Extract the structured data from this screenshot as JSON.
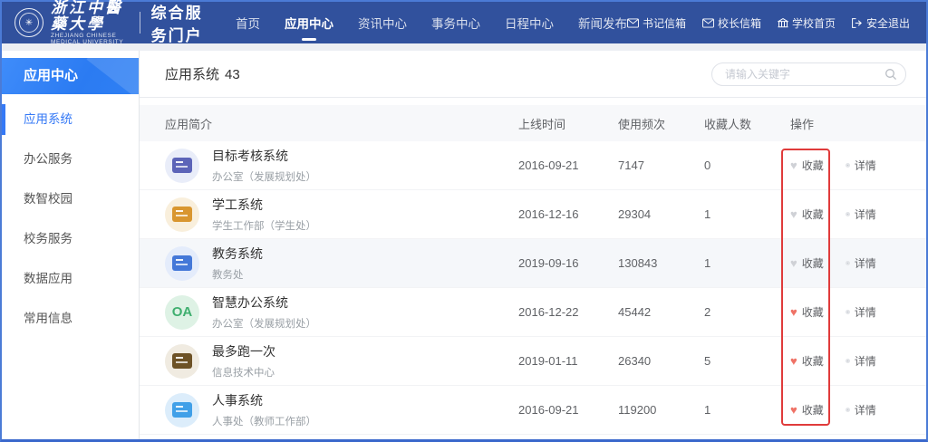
{
  "navbar": {
    "university_name": "浙江中醫藥大學",
    "university_name_en": "ZHEJIANG CHINESE MEDICAL UNIVERSITY",
    "portal_title": "综合服务门户",
    "items": [
      {
        "label": "首页",
        "active": false
      },
      {
        "label": "应用中心",
        "active": true
      },
      {
        "label": "资讯中心",
        "active": false
      },
      {
        "label": "事务中心",
        "active": false
      },
      {
        "label": "日程中心",
        "active": false
      },
      {
        "label": "新闻发布",
        "active": false
      }
    ],
    "right_links": [
      {
        "icon": "envelope-icon",
        "label": "书记信箱"
      },
      {
        "icon": "envelope-icon",
        "label": "校长信箱"
      },
      {
        "icon": "building-icon",
        "label": "学校首页"
      },
      {
        "icon": "logout-icon",
        "label": "安全退出"
      }
    ]
  },
  "sidebar": {
    "header": "应用中心",
    "items": [
      {
        "label": "应用系统",
        "active": true
      },
      {
        "label": "办公服务",
        "active": false
      },
      {
        "label": "数智校园",
        "active": false
      },
      {
        "label": "校务服务",
        "active": false
      },
      {
        "label": "数据应用",
        "active": false
      },
      {
        "label": "常用信息",
        "active": false
      }
    ]
  },
  "main": {
    "title": "应用系统",
    "count": "43",
    "search_placeholder": "请输入关键字",
    "table": {
      "headers": [
        "应用简介",
        "上线时间",
        "使用频次",
        "收藏人数",
        "操作"
      ],
      "favorite_label": "收藏",
      "detail_label": "详情",
      "rows": [
        {
          "name": "目标考核系统",
          "dept": "办公室（发展规划处）",
          "date": "2016-09-21",
          "usage": "7147",
          "favorites": "0",
          "favorited": false,
          "highlighted": false,
          "icon": {
            "bg": "#e9edf9",
            "fg": "#5c64b8",
            "text": ""
          }
        },
        {
          "name": "学工系统",
          "dept": "学生工作部（学生处）",
          "date": "2016-12-16",
          "usage": "29304",
          "favorites": "1",
          "favorited": false,
          "highlighted": false,
          "icon": {
            "bg": "#f9efdc",
            "fg": "#d9962f",
            "text": ""
          }
        },
        {
          "name": "教务系统",
          "dept": "教务处",
          "date": "2019-09-16",
          "usage": "130843",
          "favorites": "1",
          "favorited": false,
          "highlighted": true,
          "icon": {
            "bg": "#e4ecfb",
            "fg": "#4478d8",
            "text": ""
          }
        },
        {
          "name": "智慧办公系统",
          "dept": "办公室（发展规划处）",
          "date": "2016-12-22",
          "usage": "45442",
          "favorites": "2",
          "favorited": true,
          "highlighted": false,
          "icon": {
            "bg": "#def2e5",
            "fg": "#3faf6f",
            "text": "OA"
          }
        },
        {
          "name": "最多跑一次",
          "dept": "信息技术中心",
          "date": "2019-01-11",
          "usage": "26340",
          "favorites": "5",
          "favorited": true,
          "highlighted": false,
          "icon": {
            "bg": "#f0ebe1",
            "fg": "#6d5226",
            "text": ""
          }
        },
        {
          "name": "人事系统",
          "dept": "人事处（教师工作部）",
          "date": "2016-09-21",
          "usage": "119200",
          "favorites": "1",
          "favorited": true,
          "highlighted": false,
          "icon": {
            "bg": "#dcedfb",
            "fg": "#41a0e8",
            "text": ""
          }
        }
      ]
    }
  },
  "annotation": {
    "color": "#e03b3b"
  }
}
